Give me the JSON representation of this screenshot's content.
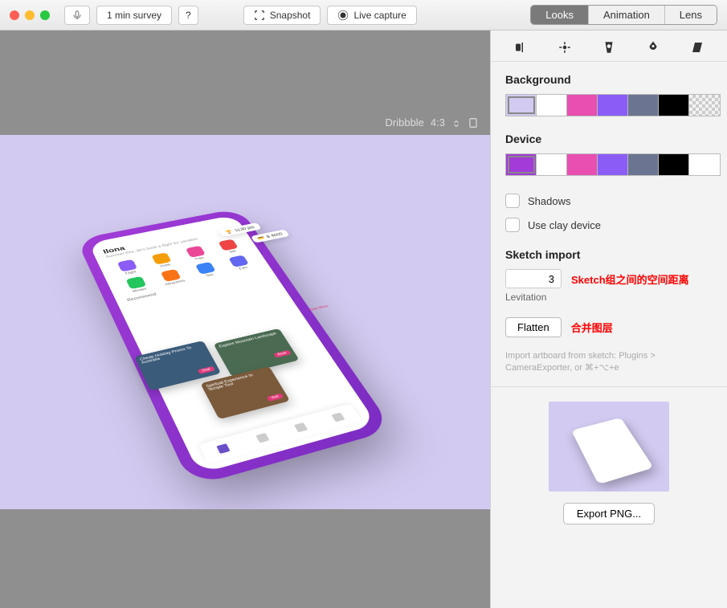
{
  "toolbar": {
    "survey": "1 min survey",
    "help": "?",
    "snapshot": "Snapshot",
    "live_capture": "Live capture",
    "tabs": {
      "looks": "Looks",
      "animation": "Animation",
      "lens": "Lens",
      "active": "looks"
    }
  },
  "canvas": {
    "preset_label": "Dribbble",
    "aspect": "4:3"
  },
  "mockup": {
    "title": "Ilona",
    "subtitle": "Summer free, let's book a flight for vacation",
    "pill_points": "1130 pts",
    "pill_price": "$ 4600",
    "icons": [
      {
        "label": "Flight",
        "color": "#8b5cf6"
      },
      {
        "label": "Hotel",
        "color": "#f59e0b"
      },
      {
        "label": "Train",
        "color": "#ec4899"
      },
      {
        "label": "Gift",
        "color": "#ef4444"
      },
      {
        "label": "Movies",
        "color": "#22c55e"
      },
      {
        "label": "Attractions",
        "color": "#f97316"
      },
      {
        "label": "Taxi",
        "color": "#3b82f6"
      },
      {
        "label": "Eats",
        "color": "#6366f1"
      }
    ],
    "recommend_label": "Recommend",
    "view_more": "View More",
    "cards": [
      {
        "title": "Cheap Holiday Promo To Australia",
        "btn": "Deal",
        "bg": "#3b5b7a"
      },
      {
        "title": "Explore Mountain Landscape",
        "btn": "Book",
        "bg": "#4a6b52"
      },
      {
        "title": "Spiritual Experience In Temple Tour",
        "btn": "Visit",
        "bg": "#7a5a3b"
      }
    ]
  },
  "sidebar": {
    "background": {
      "heading": "Background",
      "colors": [
        "#d3caf1",
        "#ffffff",
        "#e84fb0",
        "#8b5cf6",
        "#6b7490",
        "#000000",
        "checker"
      ],
      "selected": 0
    },
    "device": {
      "heading": "Device",
      "colors": [
        "#a23bd8",
        "#ffffff",
        "#e84fb0",
        "#8b5cf6",
        "#6b7490",
        "#000000",
        "#ffffff"
      ],
      "selected": 0
    },
    "shadows_label": "Shadows",
    "clay_label": "Use clay device",
    "sketch_heading": "Sketch import",
    "levitation_value": "3",
    "levitation_label": "Levitation",
    "levitation_annot": "Sketch组之间的空间距离",
    "flatten_label": "Flatten",
    "flatten_annot": "合并图层",
    "import_hint": "Import artboard from sketch: Plugins > CameraExporter, or ⌘+⌥+e",
    "export_label": "Export PNG..."
  }
}
